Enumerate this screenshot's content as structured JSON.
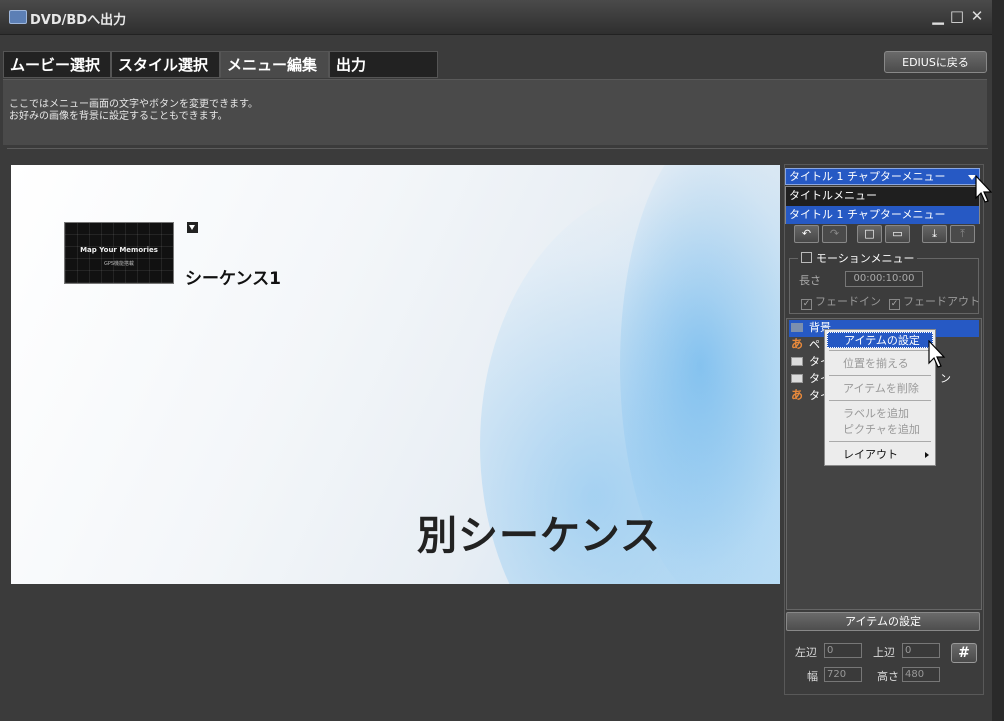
{
  "window": {
    "title": "DVD/BDへ出力",
    "controls": {
      "minimize": "▁",
      "maximize": "□",
      "close": "✕"
    }
  },
  "tabs": [
    {
      "label": "ムービー選択",
      "active": false
    },
    {
      "label": "スタイル選択",
      "active": false
    },
    {
      "label": "メニュー編集",
      "active": true
    },
    {
      "label": "出力",
      "active": false
    }
  ],
  "back_button": "EDIUSに戻る",
  "instructions": [
    "ここではメニュー画面の文字やボタンを変更できます。",
    "お好みの画像を背景に設定することもできます。"
  ],
  "preview": {
    "thumbnail_title": "Map Your Memories",
    "thumbnail_sub": "GPS機能搭載",
    "sequence_label": "シーケンス1",
    "big_label": "別シーケンス"
  },
  "menu_select": {
    "value": "タイトル 1 チャプターメニュー",
    "options": [
      "タイトルメニュー",
      "タイトル 1 チャプターメニュー"
    ]
  },
  "toolbar": {
    "undo": "↶",
    "redo": "↷",
    "safe_area": "□",
    "monitor": "▭",
    "import": "⤓",
    "export": "⤒"
  },
  "motion": {
    "label": "モーションメニュー",
    "checked": false,
    "length_label": "長さ",
    "length_value": "00:00:10:00",
    "fade_in": "フェードイン",
    "fade_out": "フェードアウト"
  },
  "tree_items": [
    {
      "icon": "folder-icon",
      "label": "背景"
    },
    {
      "icon": "text-icon",
      "label": "ペ"
    },
    {
      "icon": "picture-icon",
      "label": "タイ"
    },
    {
      "icon": "picture-icon",
      "label": "タイ"
    },
    {
      "icon": "text-icon",
      "label": "タイ"
    }
  ],
  "tree_trailing_glyph": "ン",
  "context_menu": {
    "item_settings": "アイテムの設定",
    "align": "位置を揃える",
    "delete": "アイテムを削除",
    "add_label": "ラベルを追加",
    "add_picture": "ピクチャを追加",
    "layout": "レイアウト"
  },
  "item_settings_button": "アイテムの設定",
  "position": {
    "left_label": "左辺",
    "left_value": "0",
    "top_label": "上辺",
    "top_value": "0",
    "width_label": "幅",
    "width_value": "720",
    "height_label": "高さ",
    "height_value": "480"
  },
  "grid_button": "#",
  "colors": {
    "accent": "#2659c4",
    "background": "#3b3b3b"
  }
}
